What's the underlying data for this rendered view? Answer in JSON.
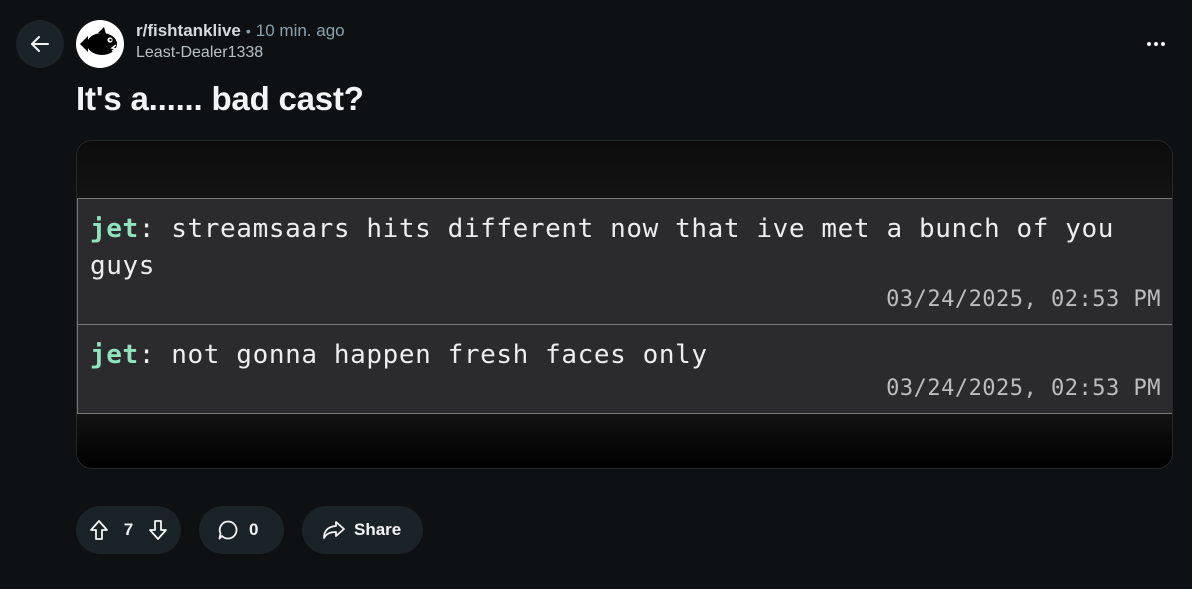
{
  "post": {
    "subreddit": "r/fishtanklive",
    "separator": "•",
    "time_ago": "10 min. ago",
    "author": "Least-Dealer1338",
    "title": "It's a...... bad cast?"
  },
  "image_messages": [
    {
      "user": "jet",
      "separator": ":",
      "text": "streamsaars hits different now that ive met a bunch of you guys",
      "timestamp": "03/24/2025, 02:53 PM"
    },
    {
      "user": "jet",
      "separator": ":",
      "text": "not gonna happen fresh faces only",
      "timestamp": "03/24/2025, 02:53 PM"
    }
  ],
  "actions": {
    "vote_count": "7",
    "comment_count": "0",
    "share_label": "Share"
  },
  "icons": {
    "back": "arrow-left-icon",
    "more": "more-horizontal-icon",
    "upvote": "upvote-arrow-icon",
    "downvote": "downvote-arrow-icon",
    "comment": "comment-bubble-icon",
    "share": "share-arrow-icon"
  },
  "colors": {
    "background": "#0e1113",
    "pill": "#1a2327",
    "username_green": "#8fe3bf"
  }
}
